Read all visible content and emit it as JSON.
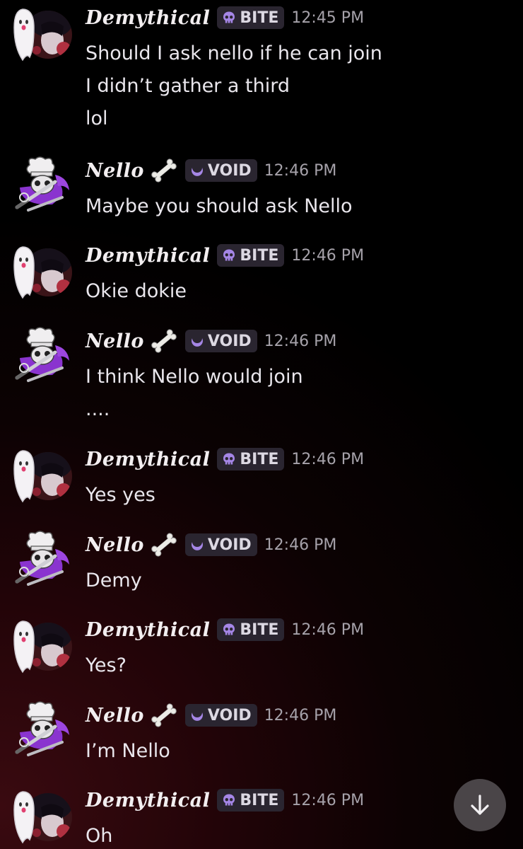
{
  "colors": {
    "tag_background": "#2a2530",
    "tag_icon_purple": "#a586e6",
    "timestamp": "#a6a2aa",
    "scroll_button": "#4a4548"
  },
  "messages": [
    {
      "user": "Demythical",
      "avatar": "ghost-avatar",
      "tag_icon": "skull-icon",
      "tag": "BITE",
      "time": "12:45 PM",
      "bone": false,
      "lines": [
        "Should I ask nello if he can join",
        "I didn’t gather a third",
        "lol"
      ]
    },
    {
      "user": "Nello",
      "avatar": "chef-skull-avatar",
      "tag_icon": "void-moon-icon",
      "tag": "VOID",
      "time": "12:46 PM",
      "bone": true,
      "lines": [
        "Maybe you should ask Nello"
      ]
    },
    {
      "user": "Demythical",
      "avatar": "ghost-avatar",
      "tag_icon": "skull-icon",
      "tag": "BITE",
      "time": "12:46 PM",
      "bone": false,
      "lines": [
        "Okie dokie"
      ]
    },
    {
      "user": "Nello",
      "avatar": "chef-skull-avatar",
      "tag_icon": "void-moon-icon",
      "tag": "VOID",
      "time": "12:46 PM",
      "bone": true,
      "lines": [
        "I think Nello would join",
        "...."
      ]
    },
    {
      "user": "Demythical",
      "avatar": "ghost-avatar",
      "tag_icon": "skull-icon",
      "tag": "BITE",
      "time": "12:46 PM",
      "bone": false,
      "lines": [
        "Yes yes"
      ]
    },
    {
      "user": "Nello",
      "avatar": "chef-skull-avatar",
      "tag_icon": "void-moon-icon",
      "tag": "VOID",
      "time": "12:46 PM",
      "bone": true,
      "lines": [
        "Demy"
      ]
    },
    {
      "user": "Demythical",
      "avatar": "ghost-avatar",
      "tag_icon": "skull-icon",
      "tag": "BITE",
      "time": "12:46 PM",
      "bone": false,
      "lines": [
        "Yes?"
      ]
    },
    {
      "user": "Nello",
      "avatar": "chef-skull-avatar",
      "tag_icon": "void-moon-icon",
      "tag": "VOID",
      "time": "12:46 PM",
      "bone": true,
      "lines": [
        "I’m Nello"
      ]
    },
    {
      "user": "Demythical",
      "avatar": "ghost-avatar",
      "tag_icon": "skull-icon",
      "tag": "BITE",
      "time": "12:46 PM",
      "bone": false,
      "lines": [
        "Oh"
      ]
    }
  ],
  "scroll_button": {
    "icon": "arrow-down-icon"
  }
}
